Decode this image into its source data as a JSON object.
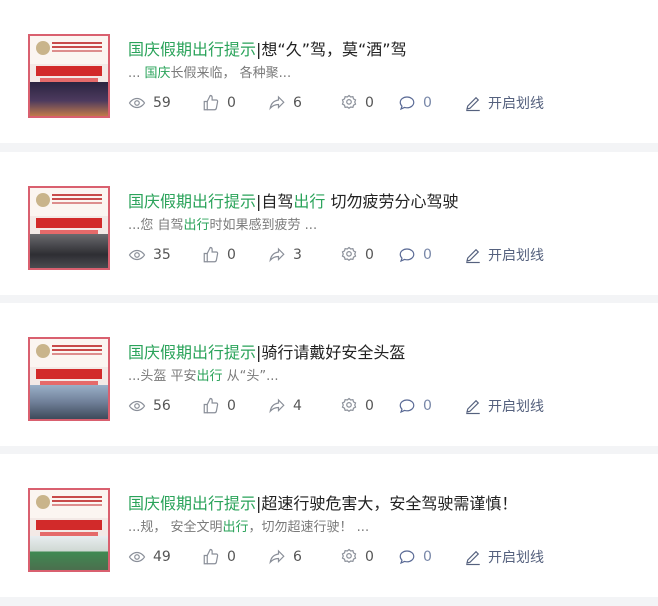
{
  "articles": [
    {
      "title_highlight_1": "国庆假期出行提示",
      "title_rest_1": "|想“久”驾，莫“酒”驾",
      "title_highlight_2": "",
      "title_rest_2": "",
      "snippet_pre": "... ",
      "snippet_highlight": "国庆",
      "snippet_post": "长假来临，  各种聚...",
      "views": "59",
      "likes": "0",
      "shares": "6",
      "gifts": "0",
      "comments": "0",
      "mark_label": "开启划线"
    },
    {
      "title_highlight_1": "国庆假期出行提示",
      "title_rest_1": "|自驾",
      "title_highlight_2": "出行",
      "title_rest_2": " 切勿疲劳分心驾驶",
      "snippet_pre": "...您 自驾",
      "snippet_highlight": "出行",
      "snippet_post": "时如果感到疲劳 ...",
      "views": "35",
      "likes": "0",
      "shares": "3",
      "gifts": "0",
      "comments": "0",
      "mark_label": "开启划线"
    },
    {
      "title_highlight_1": "国庆假期出行提示",
      "title_rest_1": "|骑行请戴好安全头盔",
      "title_highlight_2": "",
      "title_rest_2": "",
      "snippet_pre": "...头盔 平安",
      "snippet_highlight": "出行",
      "snippet_post": " 从“头”...",
      "views": "56",
      "likes": "0",
      "shares": "4",
      "gifts": "0",
      "comments": "0",
      "mark_label": "开启划线"
    },
    {
      "title_highlight_1": "国庆假期出行提示",
      "title_rest_1": "|超速行驶危害大，安全驾驶需谨慎！",
      "title_highlight_2": "",
      "title_rest_2": "",
      "snippet_pre": "...规，  安全文明",
      "snippet_highlight": "出行",
      "snippet_post": "，切勿超速行驶！  ...",
      "views": "49",
      "likes": "0",
      "shares": "6",
      "gifts": "0",
      "comments": "0",
      "mark_label": "开启划线"
    }
  ],
  "colors": {
    "highlight": "#2aa35a",
    "thumbnail_border": "#d9606f",
    "mark_button": "#55617e"
  },
  "icons": {
    "views": "eye-icon",
    "likes": "thumbs-up-icon",
    "shares": "share-arrow-icon",
    "gifts": "gift-badge-icon",
    "comments": "comment-bubble-icon",
    "mark": "pen-icon"
  }
}
